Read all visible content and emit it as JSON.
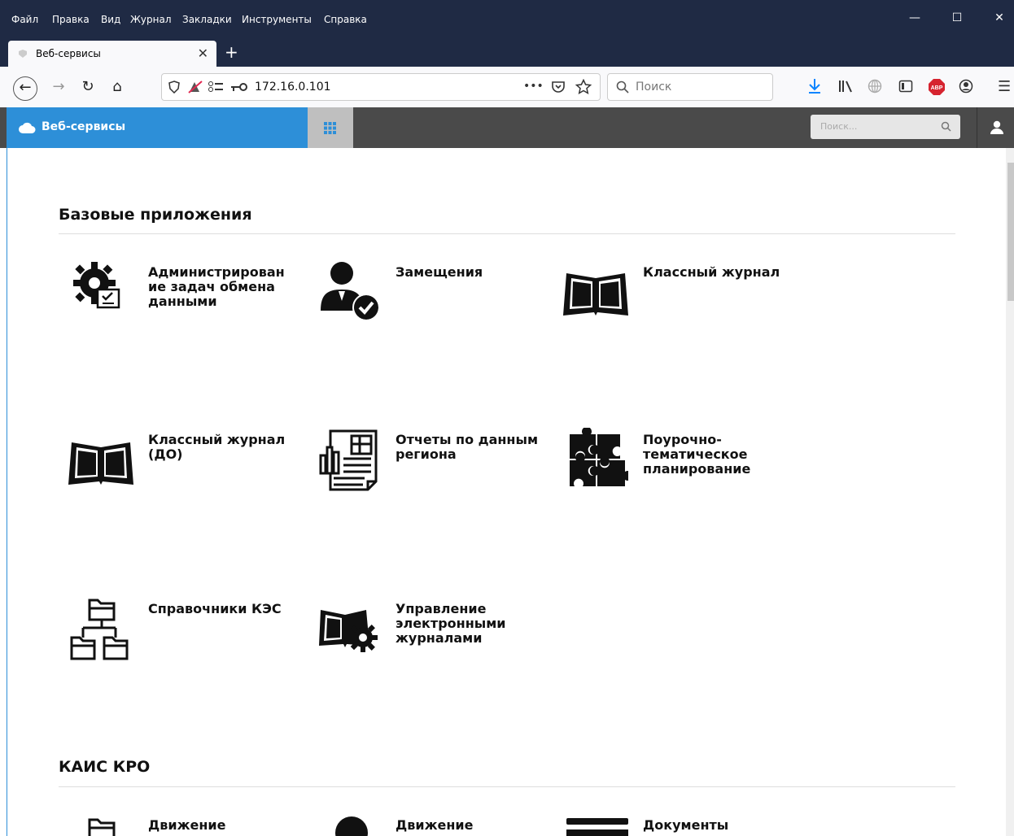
{
  "menu": [
    "Файл",
    "Правка",
    "Вид",
    "Журнал",
    "Закладки",
    "Инструменты",
    "Справка"
  ],
  "window_controls": {
    "minimize": "—",
    "maximize": "☐",
    "close": "✕"
  },
  "tab": {
    "title": "Веб-сервисы",
    "close": "✕",
    "new_tab": "+"
  },
  "nav": {
    "back": "←",
    "forward": "→",
    "reload": "↻",
    "home": "⌂",
    "url": "172.16.0.101",
    "page_actions": "•••",
    "search_placeholder": "Поиск"
  },
  "app": {
    "brand_title": "Веб-сервисы",
    "search_placeholder": "Поиск..."
  },
  "sections": [
    {
      "title": "Базовые приложения",
      "apps": [
        {
          "label": "Администрирован ие задач обмена данными",
          "icon": "gear-checklist-icon"
        },
        {
          "label": "Замещения",
          "icon": "person-check-icon"
        },
        {
          "label": "Классный журнал",
          "icon": "book-icon"
        },
        {
          "label": "Классный журнал (ДО)",
          "icon": "book-icon"
        },
        {
          "label": "Отчеты по данным региона",
          "icon": "report-icon"
        },
        {
          "label": "Поурочно-тематическое планирование",
          "icon": "puzzle-icon"
        },
        {
          "label": "Справочники КЭС",
          "icon": "folder-tree-icon"
        },
        {
          "label": "Управление электронными журналами",
          "icon": "book-gear-icon"
        }
      ]
    },
    {
      "title": "КАИС КРО",
      "apps": [
        {
          "label": "Движение",
          "icon": "folder-icon"
        },
        {
          "label": "Движение",
          "icon": "person-icon"
        },
        {
          "label": "Документы",
          "icon": "document-icon"
        }
      ]
    }
  ],
  "colors": {
    "brand": "#2d8fd8",
    "appbar": "#4a4a4a",
    "titlebar": "#1f2a44"
  }
}
